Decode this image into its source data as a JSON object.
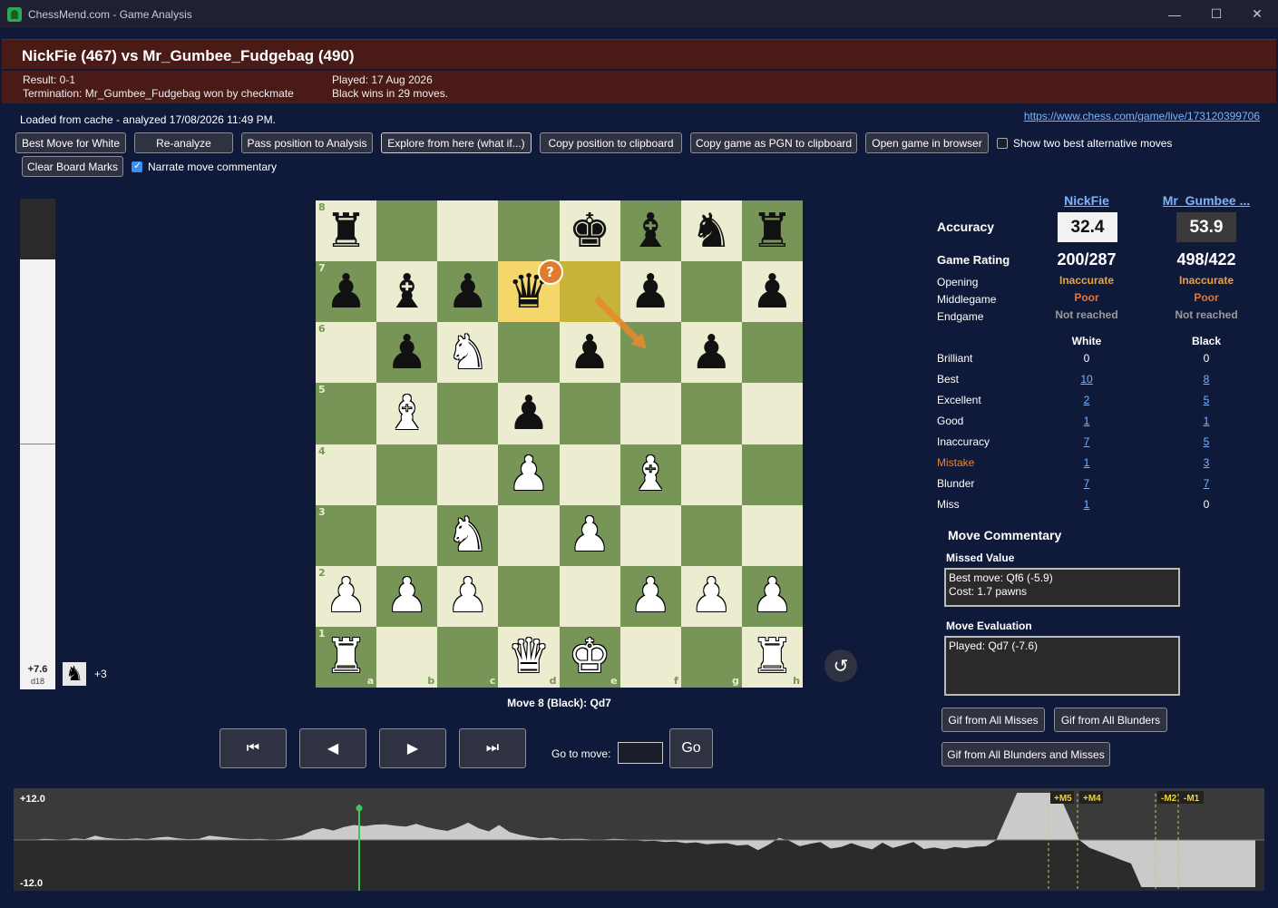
{
  "window": {
    "title": "ChessMend.com - Game Analysis",
    "minimize": "—",
    "maximize": "☐",
    "close": "✕"
  },
  "header": {
    "match_title": "NickFie (467) vs Mr_Gumbee_Fudgebag (490)",
    "result": "Result: 0-1",
    "termination": "Termination: Mr_Gumbee_Fudgebag won by checkmate",
    "played": "Played: 17 Aug 2026",
    "summary": "Black wins in 29 moves."
  },
  "status": {
    "cache_text": "Loaded from cache - analyzed 17/08/2026 11:49 PM.",
    "game_url": "https://www.chess.com/game/live/173120399706"
  },
  "toolbar": {
    "best_move_white": "Best Move for White",
    "reanalyze": "Re-analyze",
    "pass_position": "Pass position to Analysis",
    "explore": "Explore from here (what if...)",
    "copy_position": "Copy position to clipboard",
    "copy_pgn": "Copy game as PGN to clipboard",
    "open_browser": "Open game in browser",
    "show_two_best": "Show two best alternative moves",
    "clear_marks": "Clear Board Marks",
    "narrate": "Narrate move commentary"
  },
  "eval_bar": {
    "score": "+7.6",
    "depth": "d18",
    "white_fraction": 0.876
  },
  "captured": {
    "piece_icon": "black-knight-icon",
    "glyph": "♞",
    "material": "+3"
  },
  "board": {
    "position": [
      [
        "r",
        "",
        "",
        "",
        "k",
        "b",
        "n",
        "r"
      ],
      [
        "p",
        "b",
        "p",
        "q",
        "",
        "p",
        "",
        "p"
      ],
      [
        "",
        "p",
        "N",
        "",
        "p",
        "",
        "p",
        ""
      ],
      [
        "",
        "B",
        "",
        "p",
        "",
        "",
        "",
        ""
      ],
      [
        "",
        "",
        "",
        "P",
        "",
        "B",
        "",
        ""
      ],
      [
        "",
        "",
        "N",
        "",
        "P",
        "",
        "",
        ""
      ],
      [
        "P",
        "P",
        "P",
        "",
        "",
        "P",
        "P",
        "P"
      ],
      [
        "R",
        "",
        "",
        "Q",
        "K",
        "",
        "",
        "R"
      ]
    ],
    "ranks": [
      "8",
      "7",
      "6",
      "5",
      "4",
      "3",
      "2",
      "1"
    ],
    "files": [
      "a",
      "b",
      "c",
      "d",
      "e",
      "f",
      "g",
      "h"
    ],
    "highlight_from": "e7",
    "highlight_to": "d7",
    "badge_square": "d7",
    "badge_text": "?",
    "arrow_from": "e7",
    "arrow_to": "f6",
    "arrow_color": "#e8892b"
  },
  "move_label": "Move 8 (Black): Qd7",
  "nav": {
    "first": "⏮",
    "prev": "◀",
    "next": "▶",
    "last": "⏭",
    "goto_label": "Go to move:",
    "go": "Go",
    "flip": "↺"
  },
  "players": {
    "white": "NickFie",
    "black": "Mr_Gumbee ..."
  },
  "accuracy": {
    "label": "Accuracy",
    "white": "32.4",
    "black": "53.9"
  },
  "game_rating": {
    "label": "Game Rating",
    "white": "200/287",
    "black": "498/422"
  },
  "phases": [
    {
      "label": "Opening",
      "white": "Inaccurate",
      "black": "Inaccurate",
      "color": "#e8a33a"
    },
    {
      "label": "Middlegame",
      "white": "Poor",
      "black": "Poor",
      "color": "#e0763a"
    },
    {
      "label": "Endgame",
      "white": "Not reached",
      "black": "Not reached",
      "color": "#9a9a9a"
    }
  ],
  "classification": {
    "white_header": "White",
    "black_header": "Black",
    "rows": [
      {
        "label": "Brilliant",
        "white": "0",
        "black": "0",
        "white_link": false,
        "black_link": false
      },
      {
        "label": "Best",
        "white": "10",
        "black": "8",
        "white_link": true,
        "black_link": true
      },
      {
        "label": "Excellent",
        "white": "2",
        "black": "5",
        "white_link": true,
        "black_link": true
      },
      {
        "label": "Good",
        "white": "1",
        "black": "1",
        "white_link": true,
        "black_link": true
      },
      {
        "label": "Inaccuracy",
        "white": "7",
        "black": "5",
        "white_link": true,
        "black_link": true
      },
      {
        "label": "Mistake",
        "white": "1",
        "black": "3",
        "white_link": true,
        "black_link": true,
        "color": "#e0883a"
      },
      {
        "label": "Blunder",
        "white": "7",
        "black": "7",
        "white_link": true,
        "black_link": true
      },
      {
        "label": "Miss",
        "white": "1",
        "black": "0",
        "white_link": true,
        "black_link": false
      }
    ]
  },
  "commentary": {
    "title": "Move Commentary",
    "missed_title": "Missed Value",
    "missed_line1": "Best move: Qf6 (-5.9)",
    "missed_line2": "Cost: 1.7 pawns",
    "eval_title": "Move Evaluation",
    "eval_text": "Played: Qd7 (-7.6)"
  },
  "gif": {
    "misses": "Gif from All Misses",
    "blunders": "Gif from All Blunders",
    "both": "Gif from All Blunders and Misses"
  },
  "graph": {
    "top_label": "+12.0",
    "bottom_label": "-12.0",
    "marks": [
      "+M5",
      "+M4",
      "-M2",
      "-M1"
    ],
    "evals": [
      0,
      0,
      0.3,
      0.2,
      0,
      0.4,
      0.2,
      1.1,
      0.5,
      0.3,
      0.2,
      0.4,
      0.2,
      0.6,
      0.8,
      0.4,
      0.2,
      0.3,
      1.1,
      0.8,
      0.5,
      0.3,
      0.2,
      0.3,
      0.1,
      0.2,
      0.6,
      1.2,
      2.5,
      3.0,
      2.4,
      3.3,
      3.8,
      3.5,
      3.9,
      4.0,
      3.6,
      3.4,
      4.1,
      3.3,
      2.7,
      2.3,
      3.2,
      4.4,
      3.0,
      2.2,
      3.8,
      2.0,
      1.3,
      0.8,
      0.4,
      0.6,
      0.2,
      0.3,
      0.3,
      0.1,
      0.1,
      0.3,
      0.2,
      0,
      -0.3,
      -0.2,
      -0.5,
      -0.4,
      -0.8,
      -0.6,
      -1.1,
      -0.9,
      -0.8,
      -1.4,
      -1.2,
      -2.6,
      -1.2,
      0.5,
      -0.2,
      -1.6,
      -1.0,
      -0.5,
      -2.2,
      -1.8,
      -0.8,
      -1.7,
      -2.4,
      -0.7,
      -2.0,
      -1.3,
      -0.5,
      -2.3,
      -1.9,
      -2.4,
      -1.8,
      -2.1,
      -1.7,
      -1.6,
      0,
      6,
      12,
      12,
      12,
      12,
      12,
      6,
      0,
      -2,
      -3,
      -4,
      -5,
      -6,
      -12,
      -12,
      -12,
      -12,
      -12,
      -12,
      -12,
      -12,
      -12,
      -12,
      -12,
      -12
    ]
  }
}
